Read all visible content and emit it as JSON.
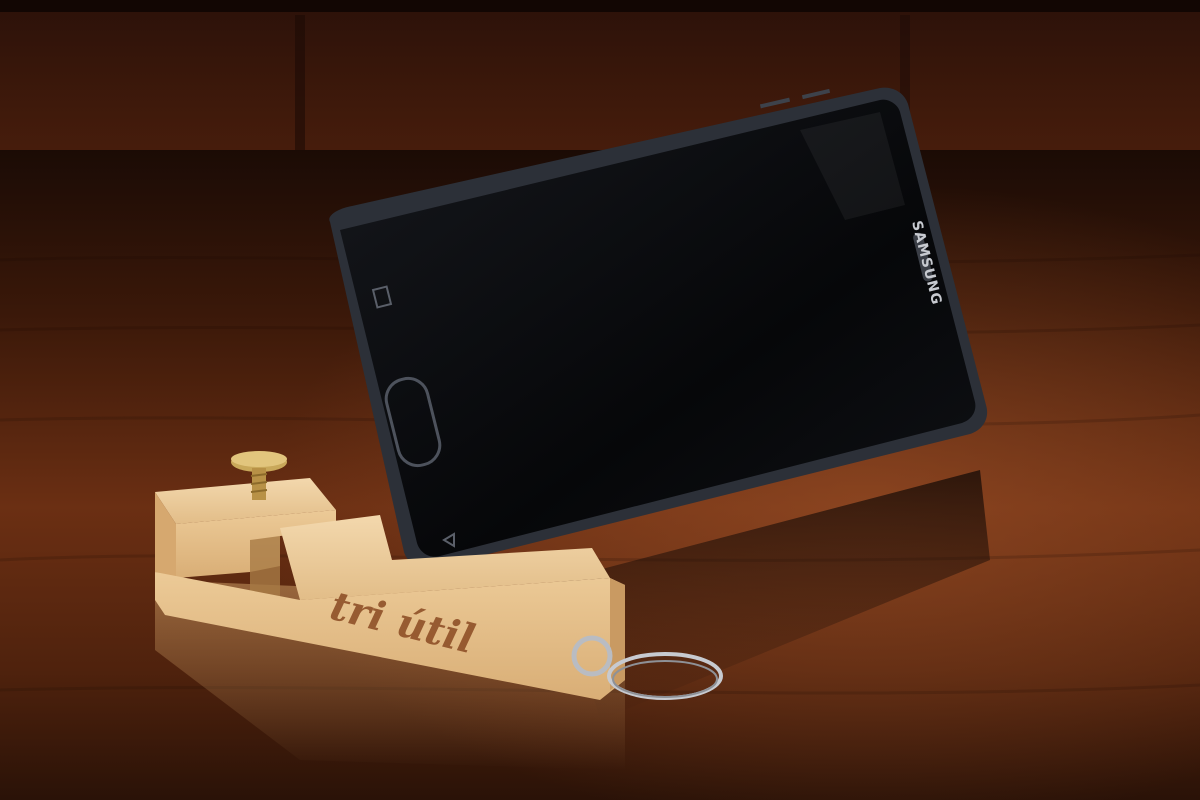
{
  "scene": {
    "description_free": true,
    "engraving_text": "tri útil",
    "phone_brand_text": "SAMSUNG",
    "colors": {
      "table_dark": "#2a1308",
      "table_mid": "#6b2f13",
      "table_highlight": "#a4552a",
      "wood_light": "#e9c99a",
      "wood_shadow": "#c9a06c",
      "phone_body": "#0b0c10",
      "phone_rim": "#2c3038",
      "brass": "#c9a85a",
      "steel": "#b9bcc2"
    }
  }
}
